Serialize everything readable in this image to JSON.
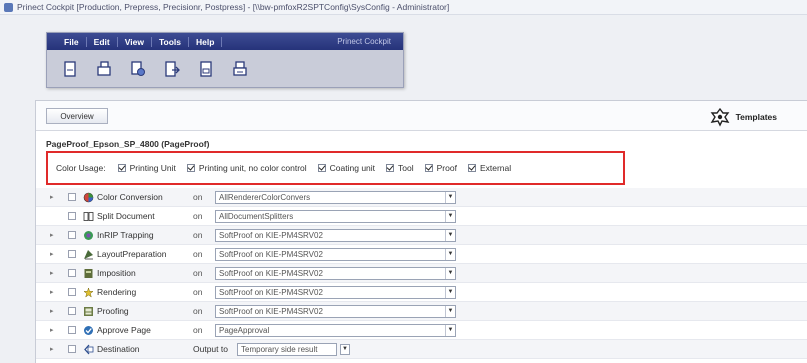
{
  "window": {
    "title": "Prinect Cockpit [Production, Prepress, Precisionr, Postpress] - [\\\\bw-pmfoxR2SPTConfig\\SysConfig - Administrator]"
  },
  "toolbar_panel": {
    "menus": [
      {
        "label": "File"
      },
      {
        "label": "Edit"
      },
      {
        "label": "View"
      },
      {
        "label": "Tools"
      },
      {
        "label": "Help"
      }
    ],
    "caption": "Prinect Cockpit",
    "tools": [
      {
        "icon": "new-document-icon"
      },
      {
        "icon": "copy-document-icon"
      },
      {
        "icon": "document-settings-icon"
      },
      {
        "icon": "export-document-icon"
      },
      {
        "icon": "document-edit-icon"
      },
      {
        "icon": "print-document-icon"
      }
    ]
  },
  "overview": {
    "button_label": "Overview",
    "templates_label": "Templates"
  },
  "page_header": "PageProof_Epson_SP_4800 (PageProof)",
  "color_usage": {
    "label": "Color Usage:",
    "options": [
      {
        "label": "Printing Unit",
        "checked": true
      },
      {
        "label": "Printing unit, no color control",
        "checked": true
      },
      {
        "label": "Coating unit",
        "checked": true
      },
      {
        "label": "Tool",
        "checked": true
      },
      {
        "label": "Proof",
        "checked": true
      },
      {
        "label": "External",
        "checked": true
      }
    ]
  },
  "steps": [
    {
      "name": "Color Conversion",
      "on": "on",
      "value": "AllRendererColorConvers",
      "icon": "color-wheel-icon",
      "has_expander": true
    },
    {
      "name": "Split Document",
      "on": "on",
      "value": "AllDocumentSplitters",
      "icon": "split-document-icon",
      "has_expander": false
    },
    {
      "name": "InRIP Trapping",
      "on": "on",
      "value": "SoftProof on KIE-PM4SRV02",
      "icon": "trapping-icon",
      "has_expander": true
    },
    {
      "name": "LayoutPreparation",
      "on": "on",
      "value": "SoftProof on KIE-PM4SRV02",
      "icon": "layout-icon",
      "has_expander": true
    },
    {
      "name": "Imposition",
      "on": "on",
      "value": "SoftProof on KIE-PM4SRV02",
      "icon": "imposition-icon",
      "has_expander": true
    },
    {
      "name": "Rendering",
      "on": "on",
      "value": "SoftProof on KIE-PM4SRV02",
      "icon": "rendering-icon",
      "has_expander": true
    },
    {
      "name": "Proofing",
      "on": "on",
      "value": "SoftProof on KIE-PM4SRV02",
      "icon": "proofing-icon",
      "has_expander": true
    },
    {
      "name": "Approve Page",
      "on": "on",
      "value": "PageApproval",
      "icon": "approve-page-icon",
      "has_expander": true
    }
  ],
  "destination": {
    "name": "Destination",
    "output_label": "Output to",
    "value": "Temporary side result",
    "icon": "destination-icon"
  }
}
